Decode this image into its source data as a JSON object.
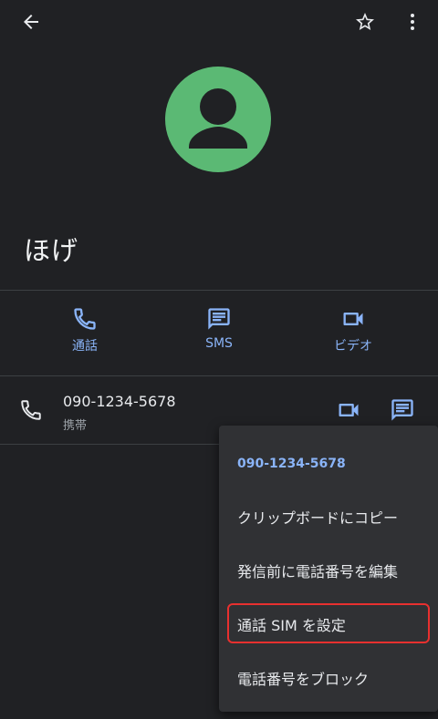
{
  "header": {
    "back_icon": "arrow-back-icon",
    "star_icon": "star-outline-icon",
    "more_icon": "more-vert-icon"
  },
  "contact": {
    "name": "ほげ",
    "avatar_color": "#5bb974"
  },
  "actions": [
    {
      "label": "通話",
      "icon": "phone-icon"
    },
    {
      "label": "SMS",
      "icon": "message-icon"
    },
    {
      "label": "ビデオ",
      "icon": "videocam-icon"
    }
  ],
  "phone": {
    "number": "090-1234-5678",
    "type": "携帯"
  },
  "menu": {
    "header": "090-1234-5678",
    "items": [
      {
        "label": "クリップボードにコピー"
      },
      {
        "label": "発信前に電話番号を編集"
      },
      {
        "label": "通話 SIM を設定"
      },
      {
        "label": "電話番号をブロック"
      }
    ]
  },
  "colors": {
    "background": "#202124",
    "accent": "#8ab4f8",
    "menu_background": "#303134",
    "highlight": "#e8302f"
  }
}
